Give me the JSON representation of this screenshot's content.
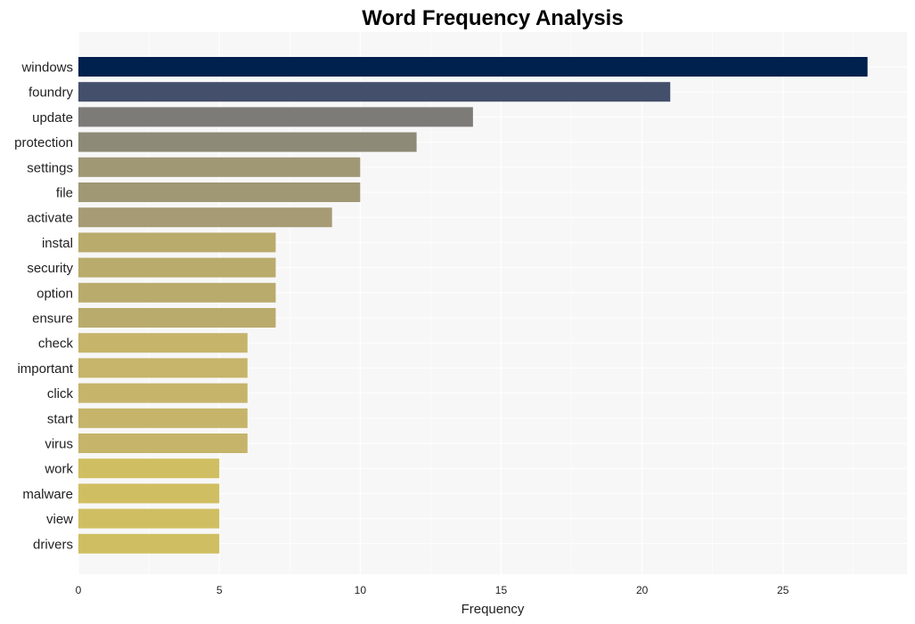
{
  "chart_data": {
    "type": "bar",
    "orientation": "horizontal",
    "title": "Word Frequency Analysis",
    "xlabel": "Frequency",
    "ylabel": "",
    "xlim": [
      0,
      29.4
    ],
    "xticks": [
      0,
      5,
      10,
      15,
      20,
      25
    ],
    "grid": true,
    "legend": "none",
    "categories": [
      "windows",
      "foundry",
      "update",
      "protection",
      "settings",
      "file",
      "activate",
      "instal",
      "security",
      "option",
      "ensure",
      "check",
      "important",
      "click",
      "start",
      "virus",
      "work",
      "malware",
      "view",
      "drivers"
    ],
    "values": [
      28,
      21,
      14,
      12,
      10,
      10,
      9,
      7,
      7,
      7,
      7,
      6,
      6,
      6,
      6,
      6,
      5,
      5,
      5,
      5
    ],
    "colors": [
      "#00204e",
      "#444f6c",
      "#7d7b78",
      "#8d8a78",
      "#a09775",
      "#a09775",
      "#a69b75",
      "#b9ab6c",
      "#b9ab6c",
      "#b9ab6c",
      "#b9ab6c",
      "#c5b46a",
      "#c5b46a",
      "#c5b46a",
      "#c5b46a",
      "#c5b46a",
      "#d0bf62",
      "#d0bf62",
      "#d0bf62",
      "#d0bf62"
    ]
  },
  "colors": {
    "plot_background": "#f7f7f7",
    "grid": "#ffffff"
  }
}
